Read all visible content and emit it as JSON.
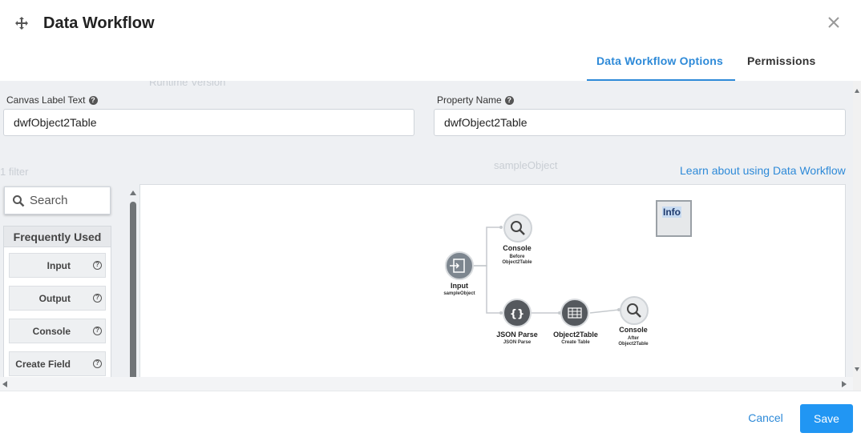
{
  "header": {
    "title": "Data Workflow",
    "tabs": [
      {
        "label": "Data Workflow Options",
        "active": true
      },
      {
        "label": "Permissions",
        "active": false
      }
    ]
  },
  "form": {
    "canvas_label": {
      "label": "Canvas Label Text",
      "value": "dwfObject2Table"
    },
    "property_name": {
      "label": "Property Name",
      "value": "dwfObject2Table"
    },
    "learn_link": "Learn about using Data Workflow"
  },
  "palette": {
    "search_placeholder": "Search",
    "section_title": "Frequently Used",
    "items": [
      "Input",
      "Output",
      "Console",
      "Create Field"
    ]
  },
  "background_ghost": {
    "version_text": "Runtime Version",
    "filter_text": "1 filter",
    "object_text": "sampleObject"
  },
  "canvas": {
    "info_label": "Info",
    "nodes": [
      {
        "title": "Input",
        "subtitle": "sampleObject"
      },
      {
        "title": "Console",
        "subtitle": "Before Object2Table"
      },
      {
        "title": "JSON Parse",
        "subtitle": "JSON Parse"
      },
      {
        "title": "Object2Table",
        "subtitle": "Create Table"
      },
      {
        "title": "Console",
        "subtitle": "After Object2Table"
      }
    ]
  },
  "footer": {
    "cancel_label": "Cancel",
    "save_label": "Save"
  },
  "colors": {
    "accent": "#2e8ad8",
    "save_button": "#2196f3",
    "node_gray": "#7d868f",
    "node_dark": "#55595e"
  }
}
